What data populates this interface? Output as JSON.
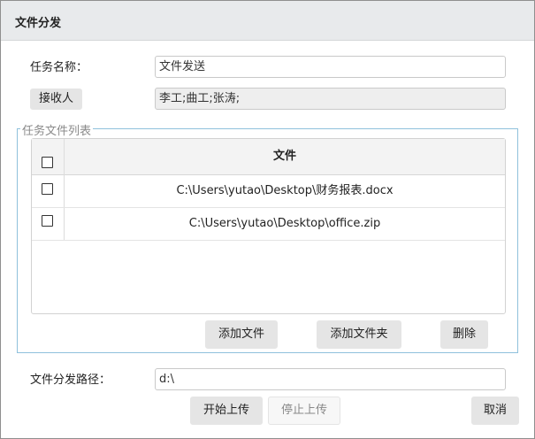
{
  "dialog": {
    "title": "文件分发"
  },
  "form": {
    "task_name_label": "任务名称：",
    "task_name_value": "文件发送",
    "receiver_button": "接收人",
    "receiver_value": "李工;曲工;张涛;",
    "file_list_legend": "任务文件列表",
    "path_label": "文件分发路径：",
    "path_value": "d:\\"
  },
  "table": {
    "header": "文件",
    "rows": [
      {
        "checked": false,
        "file": "C:\\Users\\yutao\\Desktop\\财务报表.docx"
      },
      {
        "checked": false,
        "file": "C:\\Users\\yutao\\Desktop\\office.zip"
      }
    ]
  },
  "actions": {
    "add_file": "添加文件",
    "add_folder": "添加文件夹",
    "delete": "删除",
    "start_upload": "开始上传",
    "stop_upload": "停止上传",
    "cancel": "取消"
  }
}
